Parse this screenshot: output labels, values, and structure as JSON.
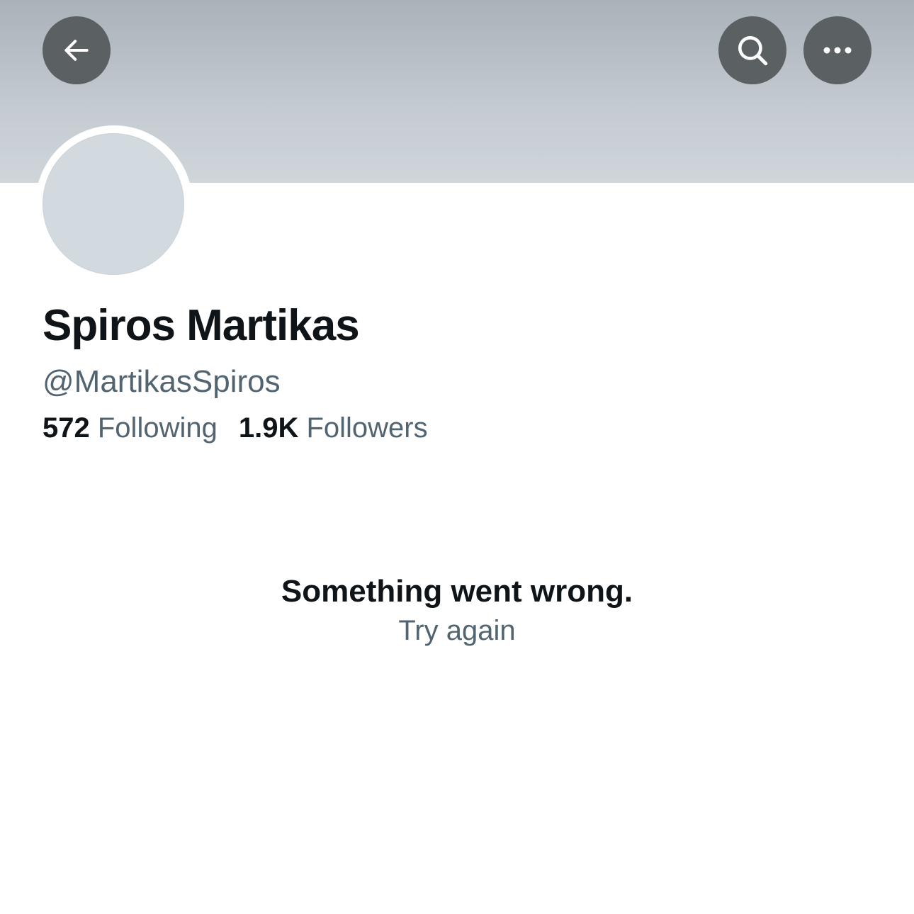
{
  "header": {
    "back_icon": "arrow-left-icon",
    "search_icon": "search-icon",
    "more_icon": "more-horizontal-icon",
    "banner_color": "#c4cbd1",
    "button_color": "#5b6063"
  },
  "profile": {
    "display_name": "Spiros Martikas",
    "handle": "@MartikasSpiros",
    "following_count": "572",
    "following_label": "Following",
    "followers_count": "1.9K",
    "followers_label": "Followers"
  },
  "error": {
    "message": "Something went wrong.",
    "retry_label": "Try again"
  }
}
